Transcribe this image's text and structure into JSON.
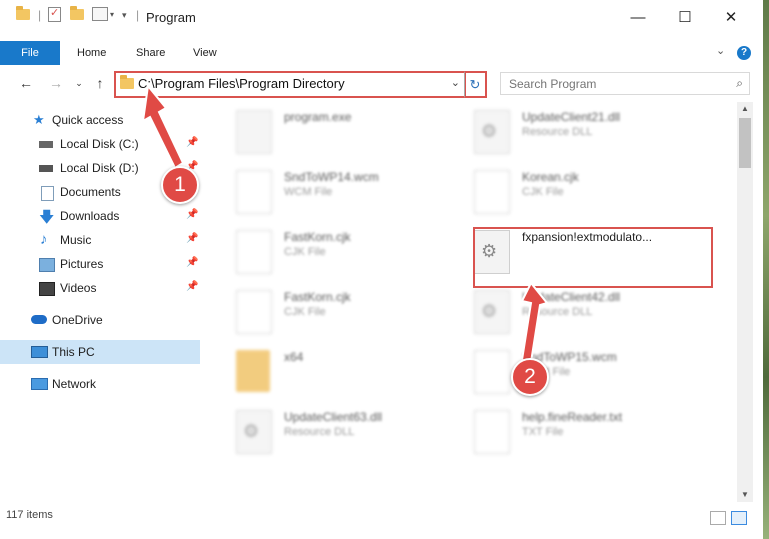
{
  "window": {
    "title": "Program",
    "controls": {
      "minimize": "—",
      "maximize": "☐",
      "close": "✕"
    }
  },
  "ribbon": {
    "tabs": [
      {
        "label": "File"
      },
      {
        "label": "Home"
      },
      {
        "label": "Share"
      },
      {
        "label": "View"
      }
    ],
    "help_label": "?"
  },
  "address_bar": {
    "path": "C:\\Program Files\\Program Directory"
  },
  "search": {
    "placeholder": "Search Program"
  },
  "sidebar": {
    "items": [
      {
        "label": "Quick access"
      },
      {
        "label": "Local Disk (C:)"
      },
      {
        "label": "Local Disk (D:)"
      },
      {
        "label": "Documents"
      },
      {
        "label": "Downloads"
      },
      {
        "label": "Music"
      },
      {
        "label": "Pictures"
      },
      {
        "label": "Videos"
      },
      {
        "label": "OneDrive"
      },
      {
        "label": "This PC"
      },
      {
        "label": "Network"
      }
    ]
  },
  "files": [
    {
      "name": "program.exe",
      "type": ""
    },
    {
      "name": "UpdateClient21.dll",
      "type": "Resource DLL"
    },
    {
      "name": "SndToWP14.wcm",
      "type": "WCM File"
    },
    {
      "name": "Korean.cjk",
      "type": "CJK File"
    },
    {
      "name": "FastKorn.cjk",
      "type": "CJK File"
    },
    {
      "name": "fxpansion!extmodulato...",
      "type": ""
    },
    {
      "name": "FastKorn.cjk",
      "type": "CJK File"
    },
    {
      "name": "UpdateClient42.dll",
      "type": "Resource DLL"
    },
    {
      "name": "x64",
      "type": ""
    },
    {
      "name": "SndToWP15.wcm",
      "type": "WCM File"
    },
    {
      "name": "UpdateClient63.dll",
      "type": "Resource DLL"
    },
    {
      "name": "help.fineReader.txt",
      "type": "TXT File"
    }
  ],
  "status": {
    "item_count": "117 items"
  },
  "callouts": [
    {
      "label": "1"
    },
    {
      "label": "2"
    }
  ],
  "colors": {
    "accent": "#1979ca",
    "highlight_red": "#d9534f",
    "badge_red": "#e04a45",
    "selected_bg": "#cce4f7"
  }
}
